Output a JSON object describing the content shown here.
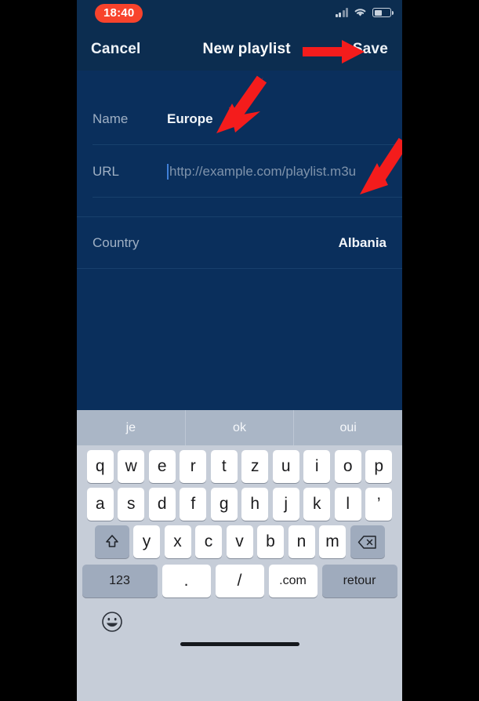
{
  "status_bar": {
    "time": "18:40",
    "time_pill_color": "#f8432c",
    "signal_icon": "cellular-signal-icon",
    "wifi_icon": "wifi-icon",
    "battery_icon": "battery-icon"
  },
  "nav_bar": {
    "cancel_label": "Cancel",
    "title": "New playlist",
    "save_label": "Save"
  },
  "form": {
    "rows": [
      {
        "label": "Name",
        "value": "Europe",
        "placeholder": ""
      },
      {
        "label": "URL",
        "value": "",
        "placeholder": "http://example.com/playlist.m3u"
      },
      {
        "label": "Country",
        "value": "Albania",
        "placeholder": ""
      }
    ]
  },
  "keyboard": {
    "suggestions": [
      "je",
      "ok",
      "oui"
    ],
    "row1": [
      "q",
      "w",
      "e",
      "r",
      "t",
      "z",
      "u",
      "i",
      "o",
      "p"
    ],
    "row2": [
      "a",
      "s",
      "d",
      "f",
      "g",
      "h",
      "j",
      "k",
      "l",
      "’"
    ],
    "row3": [
      "y",
      "x",
      "c",
      "v",
      "b",
      "n",
      "m"
    ],
    "shift_icon": "shift-arrow-icon",
    "delete_icon": "backspace-icon",
    "numbers_label": "123",
    "period_label": ".",
    "slash_label": "/",
    "dotcom_label": ".com",
    "return_label": "retour",
    "emoji_icon": "emoji-smiley-icon"
  },
  "annotations": {
    "arrow_color": "#f41c1c",
    "arrows": [
      {
        "name": "arrow-pointing-to-save",
        "direction": "right"
      },
      {
        "name": "arrow-pointing-to-name-field",
        "direction": "down-left"
      },
      {
        "name": "arrow-pointing-to-url-field",
        "direction": "down-left"
      }
    ]
  }
}
